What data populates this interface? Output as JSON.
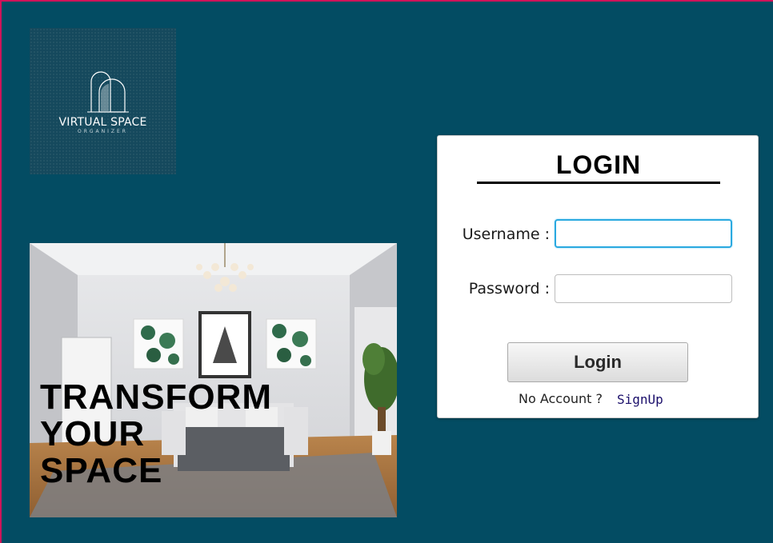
{
  "logo": {
    "title": "VIRTUAL SPACE",
    "subtitle": "ORGANIZER"
  },
  "hero": {
    "lines": [
      "TRANSFORM",
      "YOUR",
      "SPACE"
    ]
  },
  "login": {
    "title": "LOGIN",
    "username_label": "Username :",
    "username_value": "",
    "password_label": "Password :",
    "password_value": "",
    "button_label": "Login",
    "no_account_text": "No Account ?",
    "signup_link": "SignUp"
  },
  "colors": {
    "background": "#034c63",
    "focus_border": "#2aa9e0",
    "frame_border": "#d0135a",
    "signup_link": "#1b0f6b"
  }
}
